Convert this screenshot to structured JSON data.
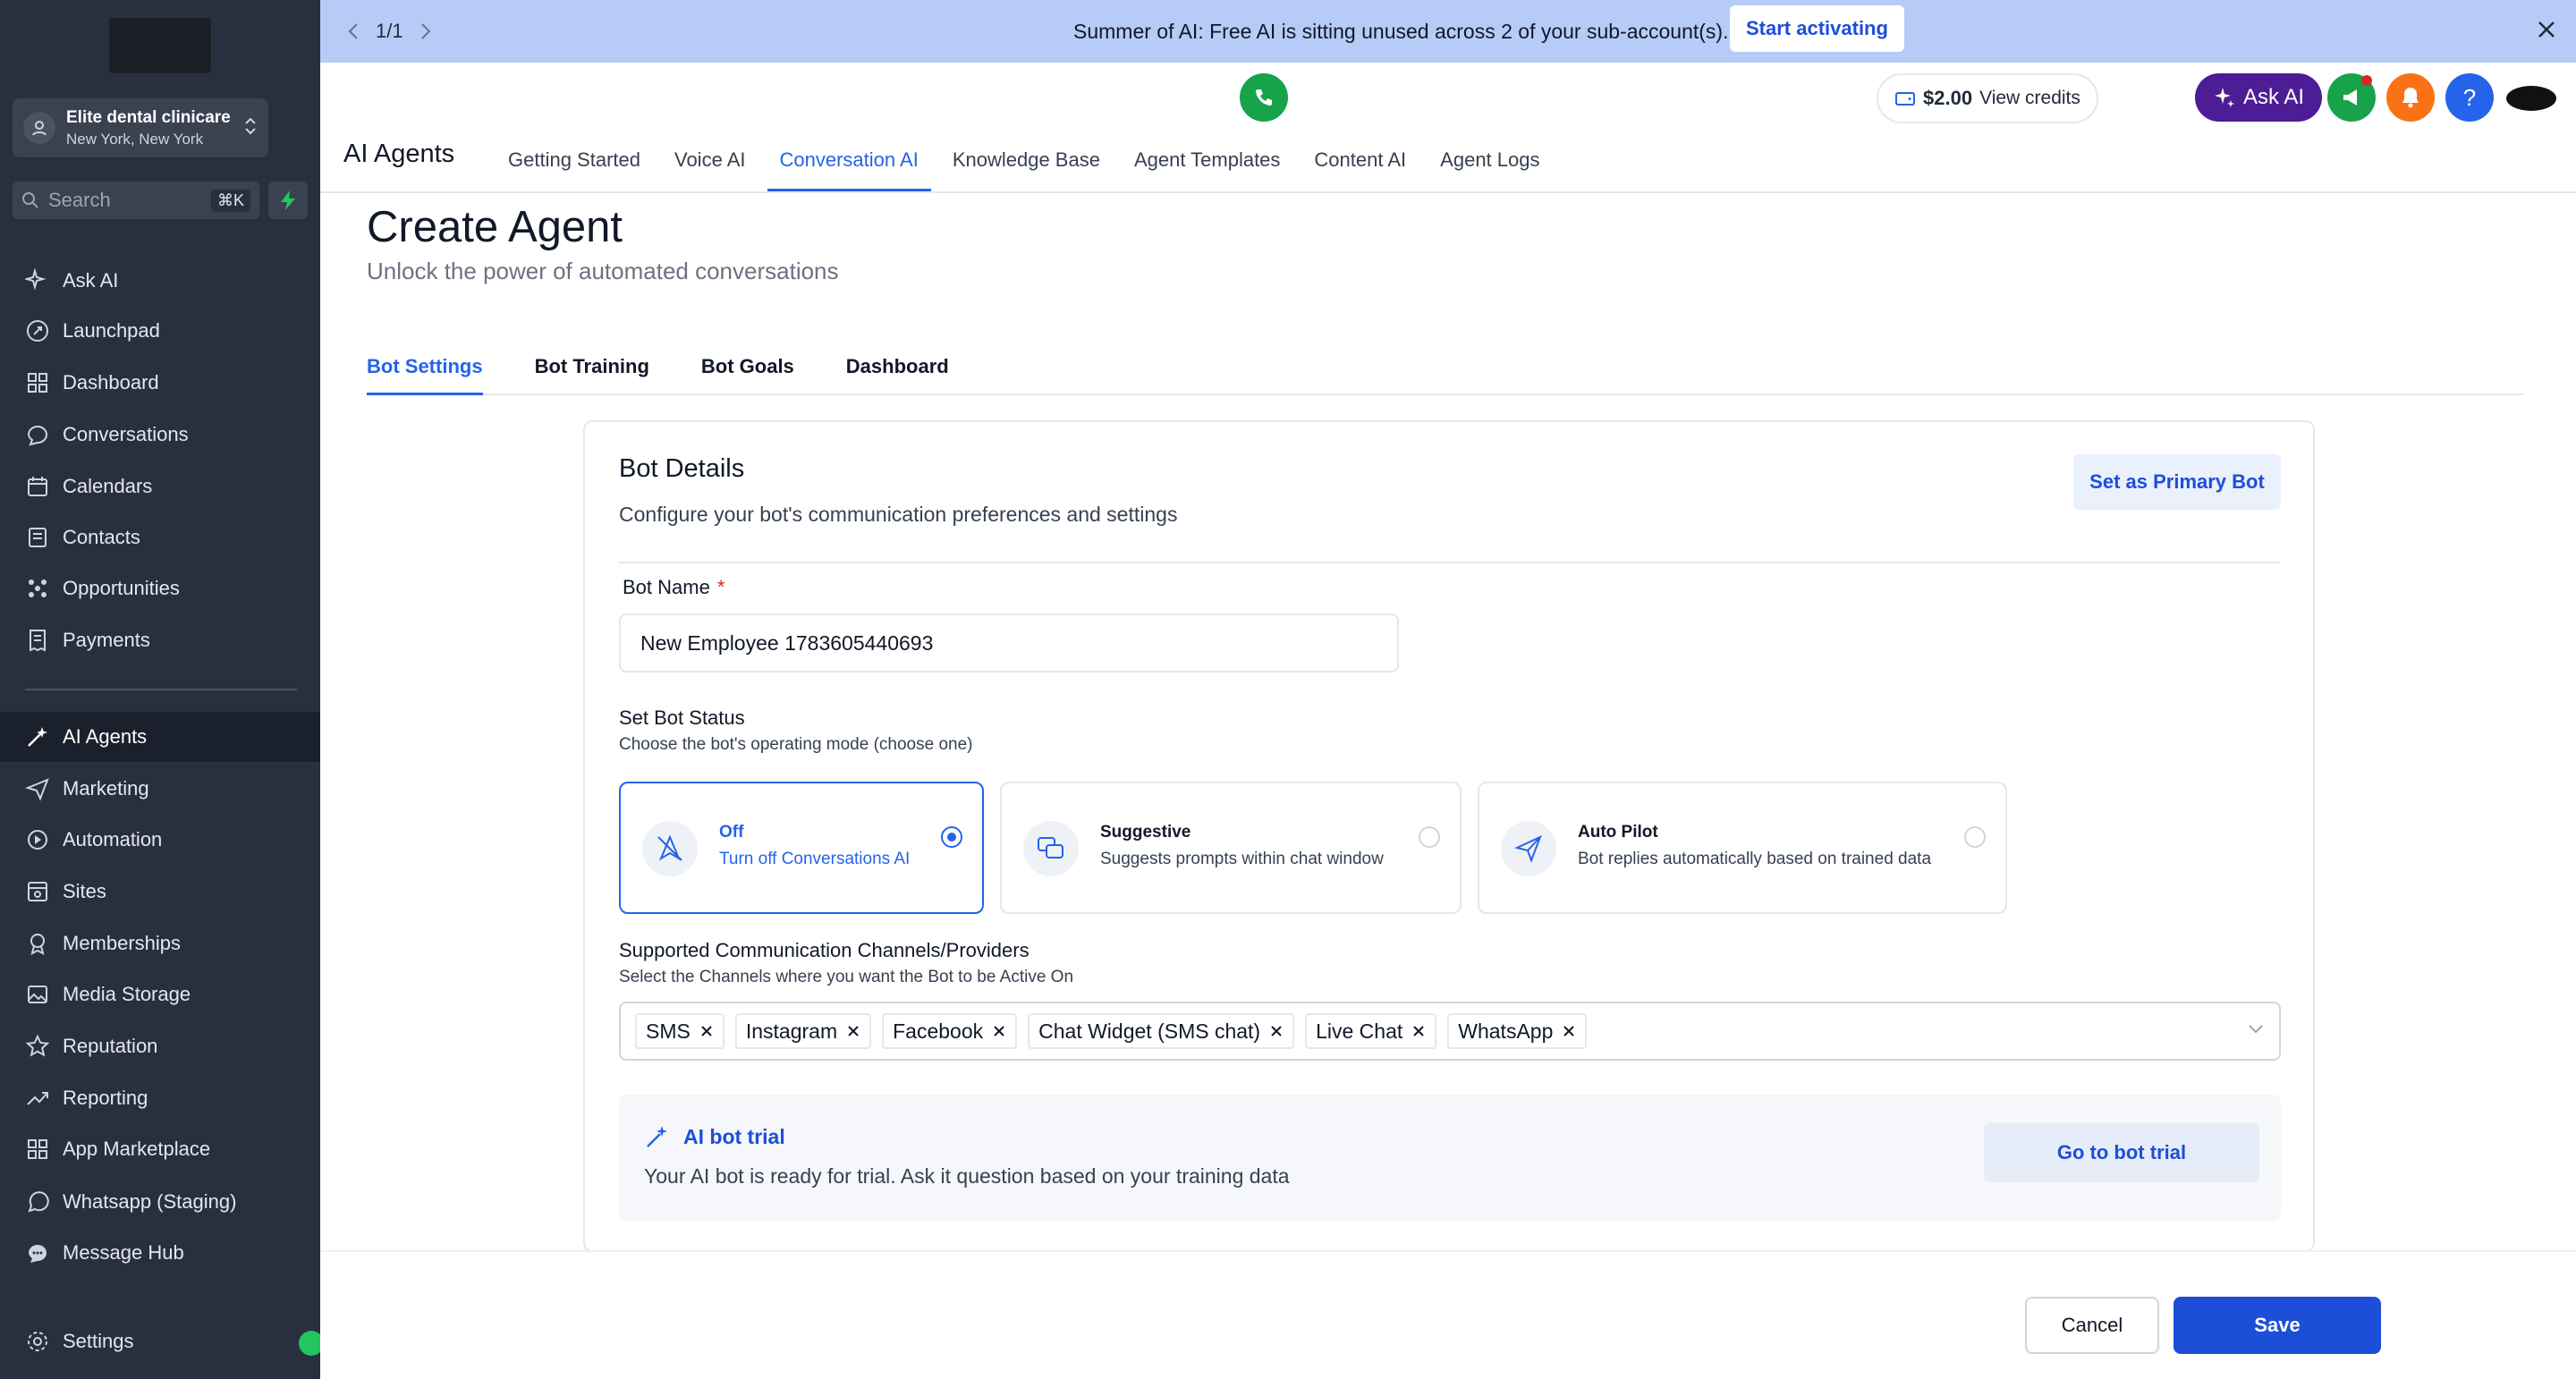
{
  "sidebar": {
    "account": {
      "name": "Elite dental clinicare",
      "location": "New York, New York"
    },
    "search": {
      "placeholder": "Search",
      "shortcut": "⌘K"
    },
    "items": [
      {
        "label": "Ask AI",
        "icon": "sparkle-icon"
      },
      {
        "label": "Launchpad",
        "icon": "rocket-icon"
      },
      {
        "label": "Dashboard",
        "icon": "grid-icon"
      },
      {
        "label": "Conversations",
        "icon": "chat-icon"
      },
      {
        "label": "Calendars",
        "icon": "calendar-icon"
      },
      {
        "label": "Contacts",
        "icon": "contacts-icon"
      },
      {
        "label": "Opportunities",
        "icon": "nodes-icon"
      },
      {
        "label": "Payments",
        "icon": "receipt-icon"
      },
      {
        "label": "AI Agents",
        "icon": "ai-agent-icon"
      },
      {
        "label": "Marketing",
        "icon": "send-icon"
      },
      {
        "label": "Automation",
        "icon": "automation-icon"
      },
      {
        "label": "Sites",
        "icon": "sites-icon"
      },
      {
        "label": "Memberships",
        "icon": "badge-icon"
      },
      {
        "label": "Media Storage",
        "icon": "image-icon"
      },
      {
        "label": "Reputation",
        "icon": "star-icon"
      },
      {
        "label": "Reporting",
        "icon": "trend-icon"
      },
      {
        "label": "App Marketplace",
        "icon": "apps-icon"
      },
      {
        "label": "Whatsapp (Staging)",
        "icon": "whatsapp-icon"
      },
      {
        "label": "Message Hub",
        "icon": "message-icon"
      },
      {
        "label": "Settings",
        "icon": "gear-icon"
      }
    ]
  },
  "banner": {
    "pager": "1/1",
    "message": "Summer of AI: Free AI is sitting unused across 2 of your sub-account(s).",
    "action": "Start activating"
  },
  "topbar": {
    "credits_amount": "$2.00",
    "credits_label": "View credits",
    "ask_ai": "Ask AI",
    "help": "?"
  },
  "header": {
    "title": "AI Agents",
    "tabs": [
      "Getting Started",
      "Voice AI",
      "Conversation AI",
      "Knowledge Base",
      "Agent Templates",
      "Content AI",
      "Agent Logs"
    ],
    "active_tab": "Conversation AI"
  },
  "page": {
    "title": "Create Agent",
    "subtitle": "Unlock the power of automated conversations",
    "tabs": [
      "Bot Settings",
      "Bot Training",
      "Bot Goals",
      "Dashboard"
    ],
    "active_tab": "Bot Settings"
  },
  "bot_details": {
    "title": "Bot Details",
    "subtitle": "Configure your bot's communication preferences and settings",
    "primary_button": "Set as Primary Bot",
    "name_label": "Bot Name",
    "required_mark": "*",
    "name_value": "New Employee 1783605440693",
    "status_label": "Set Bot Status",
    "status_hint": "Choose the bot's operating mode (choose one)",
    "status_options": [
      {
        "title": "Off",
        "desc": "Turn off Conversations AI",
        "selected": true
      },
      {
        "title": "Suggestive",
        "desc": "Suggests prompts within chat window",
        "selected": false
      },
      {
        "title": "Auto Pilot",
        "desc": "Bot replies automatically based on trained data",
        "selected": false
      }
    ],
    "channels_label": "Supported Communication Channels/Providers",
    "channels_hint": "Select the Channels where you want the Bot to be Active On",
    "channels": [
      "SMS",
      "Instagram",
      "Facebook",
      "Chat Widget (SMS chat)",
      "Live Chat",
      "WhatsApp"
    ],
    "trial": {
      "title": "AI bot trial",
      "desc": "Your AI bot is ready for trial. Ask it question based on your training data",
      "button": "Go to bot trial"
    }
  },
  "footer": {
    "cancel": "Cancel",
    "save": "Save"
  },
  "colors": {
    "accent": "#2563eb",
    "sidebar": "#28303f",
    "banner": "#b7cbf7",
    "ask_ai": "#4c1d95"
  }
}
